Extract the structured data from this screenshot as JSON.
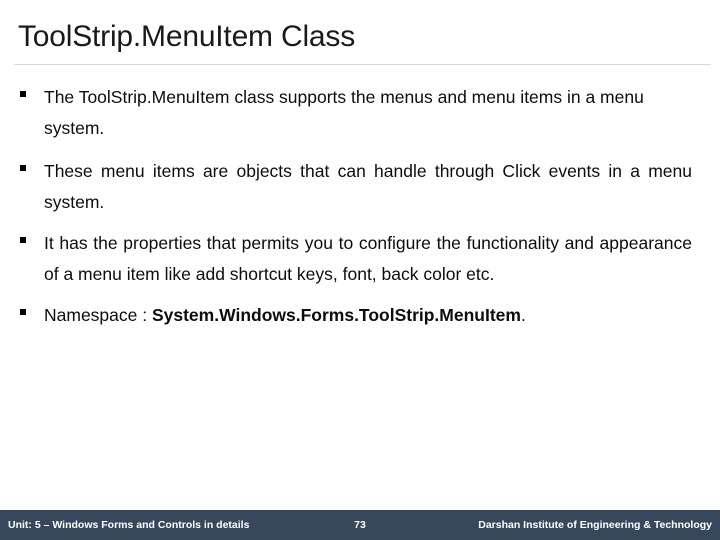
{
  "slide": {
    "title": "ToolStrip.MenuItem Class",
    "bullets": [
      {
        "marker": "square-bullet",
        "text": "The ToolStrip.MenuItem class supports the menus and menu items in a menu system.",
        "align": "left",
        "bold_part": ""
      },
      {
        "marker": "square-bullet",
        "text": "These menu items are objects that can handle through Click events in a menu system.",
        "align": "justify",
        "bold_part": ""
      },
      {
        "marker": "square-bullet",
        "text": "It has the properties that permits you to configure the functionality and appearance of a menu item like add shortcut keys, font, back color etc.",
        "align": "justify",
        "bold_part": ""
      },
      {
        "marker": "square-bullet",
        "text": "Namespace : ",
        "align": "left",
        "bold_part": "System.Windows.Forms.ToolStrip.MenuItem",
        "text_tail": "."
      }
    ]
  },
  "footer": {
    "left_label": "Unit: 5 – Windows Forms and Controls in details",
    "page_number": "73",
    "right_label": "Darshan Institute of Engineering & Technology",
    "background_color": "#37485c",
    "text_color": "#ffffff"
  },
  "theme": {
    "title_color": "#1a1a1a",
    "body_color": "#0d0d0d",
    "rule_color": "#d9d9d9",
    "page_background": "#ffffff"
  }
}
